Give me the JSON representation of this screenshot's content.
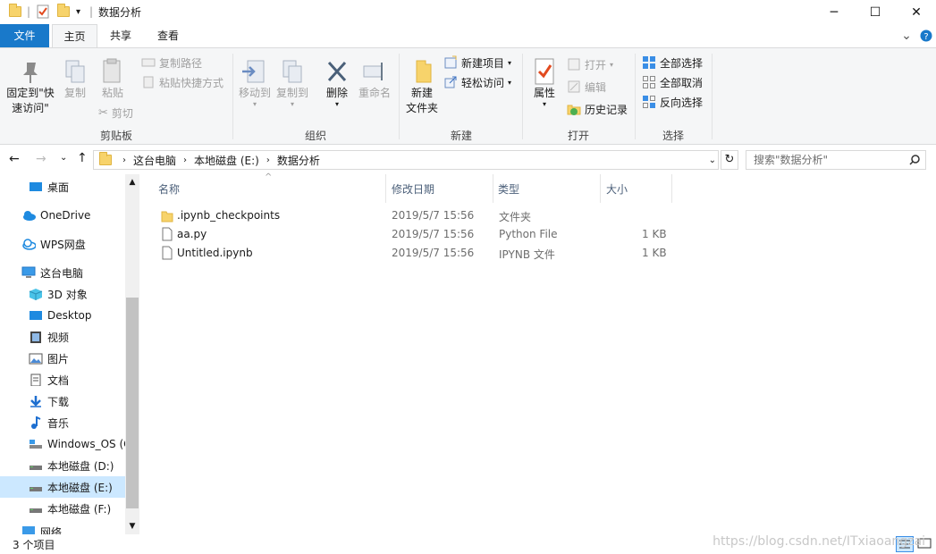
{
  "window": {
    "title": "数据分析"
  },
  "tabs": {
    "file": "文件",
    "home": "主页",
    "share": "共享",
    "view": "查看"
  },
  "ribbon": {
    "pin_line1": "固定到\"快",
    "pin_line2": "速访问\"",
    "copy": "复制",
    "paste": "粘贴",
    "copy_path": "复制路径",
    "paste_shortcut": "粘贴快捷方式",
    "cut": "剪切",
    "clipboard_label": "剪贴板",
    "move_to": "移动到",
    "copy_to": "复制到",
    "delete": "删除",
    "rename": "重命名",
    "organize_label": "组织",
    "new_folder_line1": "新建",
    "new_folder_line2": "文件夹",
    "new_item": "新建项目",
    "easy_access": "轻松访问",
    "new_label": "新建",
    "properties": "属性",
    "open": "打开",
    "edit": "编辑",
    "history": "历史记录",
    "open_label": "打开",
    "select_all": "全部选择",
    "select_none": "全部取消",
    "invert_selection": "反向选择",
    "select_label": "选择"
  },
  "address": {
    "crumbs": [
      "这台电脑",
      "本地磁盘 (E:)",
      "数据分析"
    ],
    "search_placeholder": "搜索\"数据分析\""
  },
  "nav": {
    "items": [
      {
        "label": "桌面",
        "icon": "desktop-icon"
      },
      {
        "label": "OneDrive",
        "icon": "cloud-icon"
      },
      {
        "label": "WPS网盘",
        "icon": "wps-cloud-icon"
      },
      {
        "label": "这台电脑",
        "icon": "computer-icon"
      },
      {
        "label": "3D 对象",
        "icon": "3d-objects-icon"
      },
      {
        "label": "Desktop",
        "icon": "desktop-icon"
      },
      {
        "label": "视频",
        "icon": "video-icon"
      },
      {
        "label": "图片",
        "icon": "picture-icon"
      },
      {
        "label": "文档",
        "icon": "document-icon"
      },
      {
        "label": "下载",
        "icon": "download-icon"
      },
      {
        "label": "音乐",
        "icon": "music-icon"
      },
      {
        "label": "Windows_OS (C",
        "icon": "drive-icon"
      },
      {
        "label": "本地磁盘 (D:)",
        "icon": "drive-icon"
      },
      {
        "label": "本地磁盘 (E:)",
        "icon": "drive-icon"
      },
      {
        "label": "本地磁盘 (F:)",
        "icon": "drive-icon"
      },
      {
        "label": "网络",
        "icon": "network-icon"
      }
    ]
  },
  "columns": {
    "name": "名称",
    "modified": "修改日期",
    "type": "类型",
    "size": "大小"
  },
  "files": [
    {
      "name": ".ipynb_checkpoints",
      "modified": "2019/5/7 15:56",
      "type": "文件夹",
      "size": "",
      "icon": "folder-icon"
    },
    {
      "name": "aa.py",
      "modified": "2019/5/7 15:56",
      "type": "Python File",
      "size": "1 KB",
      "icon": "file-icon"
    },
    {
      "name": "Untitled.ipynb",
      "modified": "2019/5/7 15:56",
      "type": "IPYNB 文件",
      "size": "1 KB",
      "icon": "file-icon"
    }
  ],
  "status": {
    "count": "3 个项目"
  },
  "watermark": "https://blog.csdn.net/ITxiaoangzai",
  "colors": {
    "accent": "#1979ca",
    "selection": "#cce8ff",
    "folder": "#f7d36b"
  }
}
